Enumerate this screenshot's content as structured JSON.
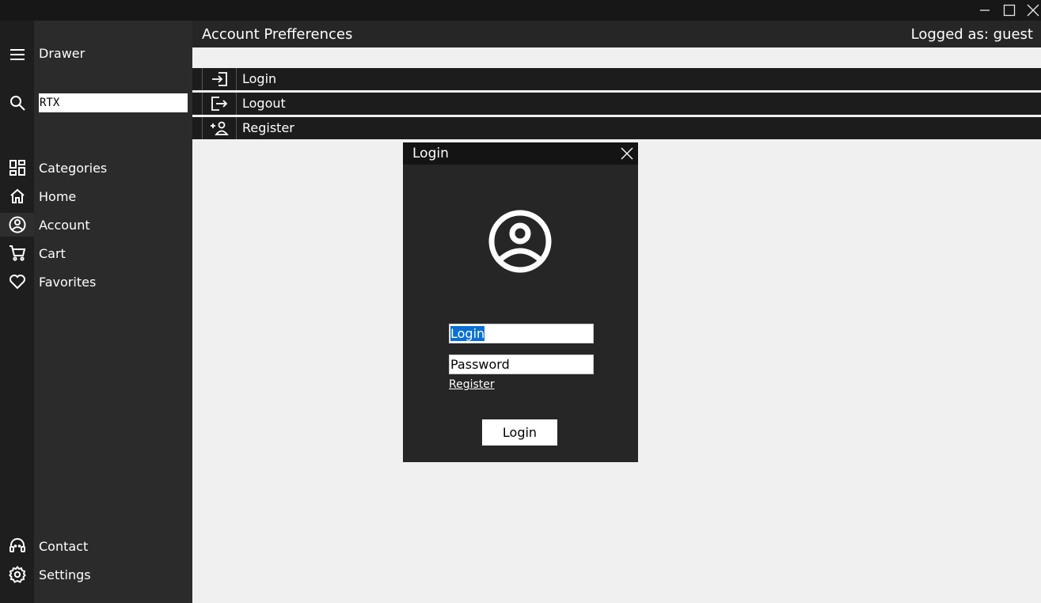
{
  "window": {
    "controls": [
      {
        "name": "minimize-icon"
      },
      {
        "name": "maximize-icon"
      },
      {
        "name": "close-icon"
      }
    ]
  },
  "sidebar": {
    "drawer_label": "Drawer",
    "search_value": "RTX",
    "items": [
      {
        "label": "Categories",
        "icon": "grid-icon"
      },
      {
        "label": "Home",
        "icon": "home-icon"
      },
      {
        "label": "Account",
        "icon": "account-circle-icon"
      },
      {
        "label": "Cart",
        "icon": "cart-icon"
      },
      {
        "label": "Favorites",
        "icon": "heart-icon"
      }
    ],
    "bottom_items": [
      {
        "label": "Contact",
        "icon": "headset-icon"
      },
      {
        "label": "Settings",
        "icon": "gear-icon"
      }
    ]
  },
  "header": {
    "title": "Account Prefferences",
    "user_status": "Logged as: guest"
  },
  "account_menu": [
    {
      "label": "Login",
      "icon": "login-icon"
    },
    {
      "label": "Logout",
      "icon": "logout-icon"
    },
    {
      "label": "Register",
      "icon": "add-person-icon"
    }
  ],
  "login_dialog": {
    "title": "Login",
    "login_field_value": "Login",
    "password_field_value": "Password",
    "register_link": "Register",
    "submit_label": "Login"
  },
  "colors": {
    "accent_selection": "#0a6fd6",
    "rail_bg": "#1e1e1e",
    "drawer_bg": "#2b2b2b",
    "content_bg": "#f0f0f0"
  }
}
